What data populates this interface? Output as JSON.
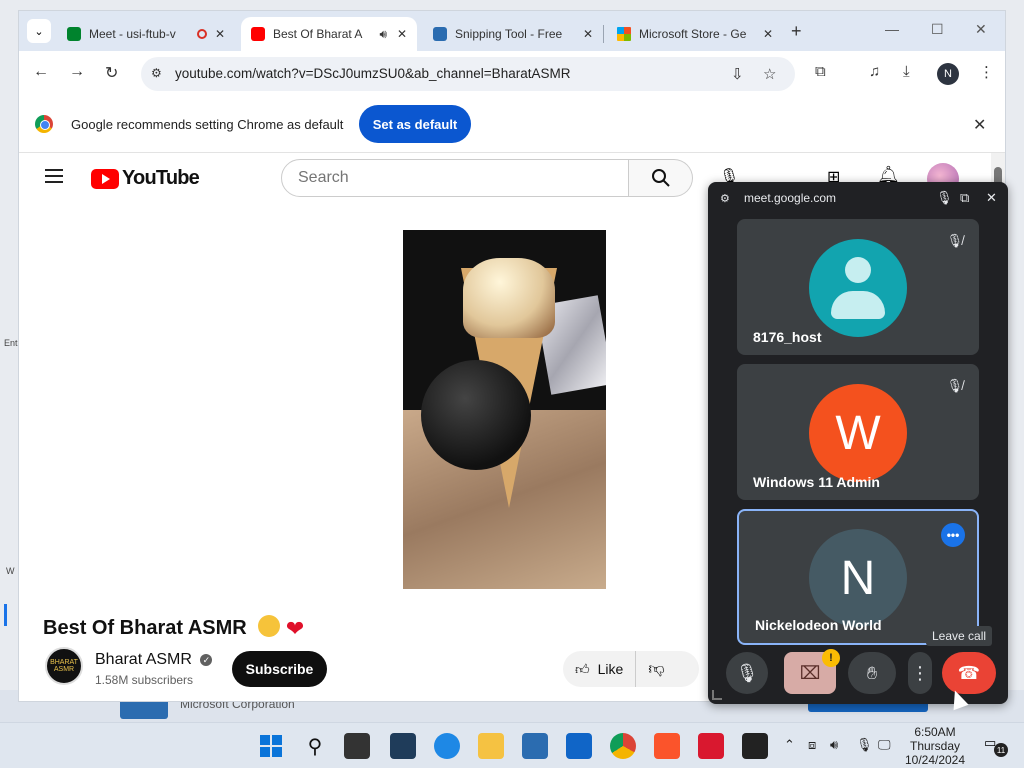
{
  "browser": {
    "tabs": [
      {
        "title": "Meet - usi-ftub-v",
        "favicon": "meet-icon",
        "color": "#00832d",
        "active": false
      },
      {
        "title": "Best Of Bharat A",
        "favicon": "youtube-icon",
        "color": "#ff0000",
        "active": true
      },
      {
        "title": "Snipping Tool - Free",
        "favicon": "store-icon",
        "color": "#2b6cb0",
        "active": false
      },
      {
        "title": "Microsoft Store - Ge",
        "favicon": "microsoft-icon",
        "color": "#f25022",
        "active": false
      }
    ],
    "url": "youtube.com/watch?v=DScJ0umzSU0&ab_channel=BharatASMR",
    "profile_initial": "N"
  },
  "infobar": {
    "message": "Google recommends setting Chrome as default",
    "button": "Set as default"
  },
  "youtube": {
    "brand": "YouTube",
    "search_placeholder": "Search",
    "video_title": "Best Of Bharat ASMR",
    "channel_name": "Bharat ASMR",
    "channel_avatar_text": "BHARAT ASMR",
    "subscribers": "1.58M subscribers",
    "subscribe_label": "Subscribe",
    "like_label": "Like"
  },
  "meet": {
    "site": "meet.google.com",
    "participants": [
      {
        "name": "8176_host",
        "initial": "",
        "avatar_color": "#12a4af",
        "muted": true
      },
      {
        "name": "Windows 11 Admin",
        "initial": "W",
        "avatar_color": "#f4511e",
        "muted": true
      },
      {
        "name": "Nickelodeon World",
        "initial": "N",
        "avatar_color": "#455a64",
        "muted": false
      }
    ],
    "tooltip": "Leave call",
    "warning_mark": "!"
  },
  "desktop": {
    "store_publisher": "Microsoft Corporation",
    "edge_left_top": "Ent",
    "edge_left_bottom": "W"
  },
  "taskbar": {
    "time": "6:50AM",
    "day": "Thursday",
    "date": "10/24/2024",
    "notification_count": "11"
  }
}
